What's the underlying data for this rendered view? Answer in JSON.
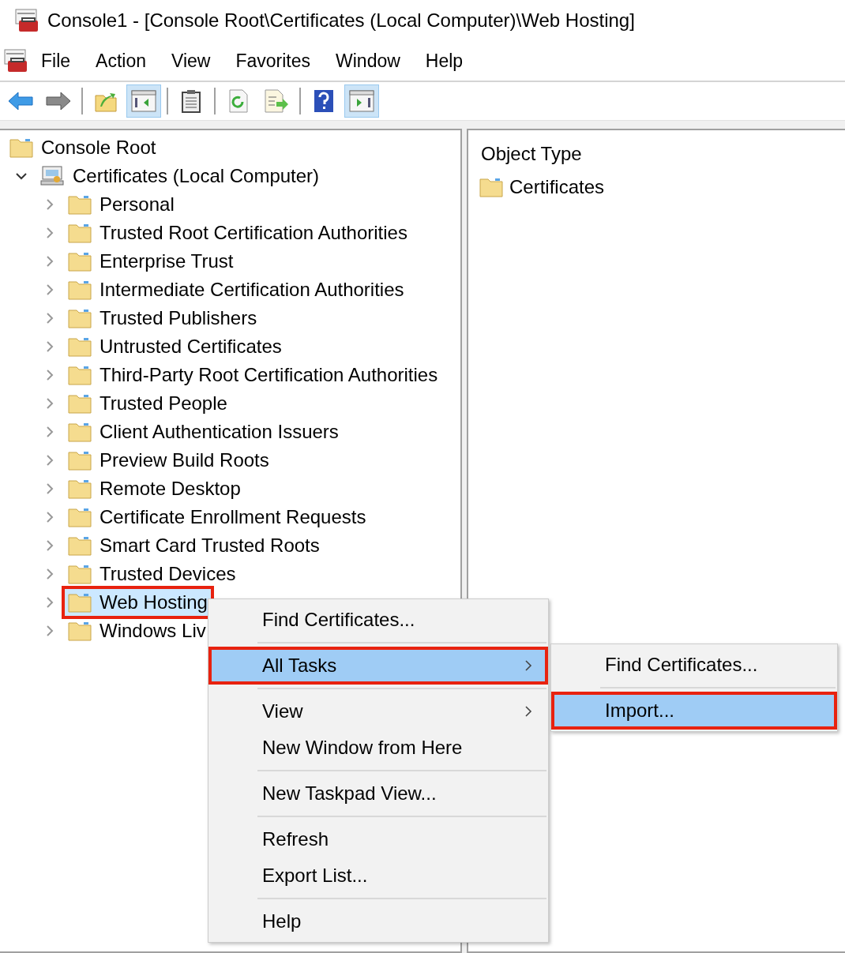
{
  "window": {
    "title": "Console1 - [Console Root\\Certificates (Local Computer)\\Web Hosting]"
  },
  "menu_bar": [
    "File",
    "Action",
    "View",
    "Favorites",
    "Window",
    "Help"
  ],
  "toolbar": [
    {
      "kind": "back",
      "pressed": false
    },
    {
      "kind": "forward",
      "pressed": false
    },
    {
      "kind": "separator"
    },
    {
      "kind": "up",
      "pressed": false
    },
    {
      "kind": "tree",
      "pressed": true
    },
    {
      "kind": "separator"
    },
    {
      "kind": "clipboard",
      "pressed": false
    },
    {
      "kind": "separator"
    },
    {
      "kind": "refresh",
      "pressed": false
    },
    {
      "kind": "export",
      "pressed": false
    },
    {
      "kind": "separator"
    },
    {
      "kind": "help",
      "pressed": false
    },
    {
      "kind": "action-pane",
      "pressed": true
    }
  ],
  "tree": [
    {
      "label": "Console Root",
      "children": [
        {
          "label": "Certificates (Local Computer)",
          "expanded": true,
          "children": [
            {
              "label": "Personal",
              "selected": false,
              "highlighted": false
            },
            {
              "label": "Trusted Root Certification Authorities",
              "selected": false,
              "highlighted": false
            },
            {
              "label": "Enterprise Trust",
              "selected": false,
              "highlighted": false
            },
            {
              "label": "Intermediate Certification Authorities",
              "selected": false,
              "highlighted": false
            },
            {
              "label": "Trusted Publishers",
              "selected": false,
              "highlighted": false
            },
            {
              "label": "Untrusted Certificates",
              "selected": false,
              "highlighted": false
            },
            {
              "label": "Third-Party Root Certification Authorities",
              "selected": false,
              "highlighted": false
            },
            {
              "label": "Trusted People",
              "selected": false,
              "highlighted": false
            },
            {
              "label": "Client Authentication Issuers",
              "selected": false,
              "highlighted": false
            },
            {
              "label": "Preview Build Roots",
              "selected": false,
              "highlighted": false
            },
            {
              "label": "Remote Desktop",
              "selected": false,
              "highlighted": false
            },
            {
              "label": "Certificate Enrollment Requests",
              "selected": false,
              "highlighted": false
            },
            {
              "label": "Smart Card Trusted Roots",
              "selected": false,
              "highlighted": false
            },
            {
              "label": "Trusted Devices",
              "selected": false,
              "highlighted": false
            },
            {
              "label": "Web Hosting",
              "selected": true,
              "highlighted": true
            },
            {
              "label": "Windows Liv",
              "selected": false,
              "highlighted": false
            }
          ]
        }
      ]
    }
  ],
  "list": {
    "column": "Object Type",
    "items": [
      "Certificates"
    ]
  },
  "context_menu": [
    {
      "kind": "item",
      "label": "Find Certificates...",
      "selected": false,
      "highlighted": false,
      "submenu": false
    },
    {
      "kind": "separator"
    },
    {
      "kind": "item",
      "label": "All Tasks",
      "selected": true,
      "highlighted": true,
      "submenu": true
    },
    {
      "kind": "separator"
    },
    {
      "kind": "item",
      "label": "View",
      "selected": false,
      "highlighted": false,
      "submenu": true
    },
    {
      "kind": "item",
      "label": "New Window from Here",
      "selected": false,
      "highlighted": false,
      "submenu": false
    },
    {
      "kind": "separator"
    },
    {
      "kind": "item",
      "label": "New Taskpad View...",
      "selected": false,
      "highlighted": false,
      "submenu": false
    },
    {
      "kind": "separator"
    },
    {
      "kind": "item",
      "label": "Refresh",
      "selected": false,
      "highlighted": false,
      "submenu": false
    },
    {
      "kind": "item",
      "label": "Export List...",
      "selected": false,
      "highlighted": false,
      "submenu": false
    },
    {
      "kind": "separator"
    },
    {
      "kind": "item",
      "label": "Help",
      "selected": false,
      "highlighted": false,
      "submenu": false
    }
  ],
  "submenu": [
    {
      "kind": "item",
      "label": "Find Certificates...",
      "selected": false,
      "highlighted": false,
      "submenu": false
    },
    {
      "kind": "separator"
    },
    {
      "kind": "item",
      "label": "Import...",
      "selected": true,
      "highlighted": true,
      "submenu": false
    }
  ]
}
